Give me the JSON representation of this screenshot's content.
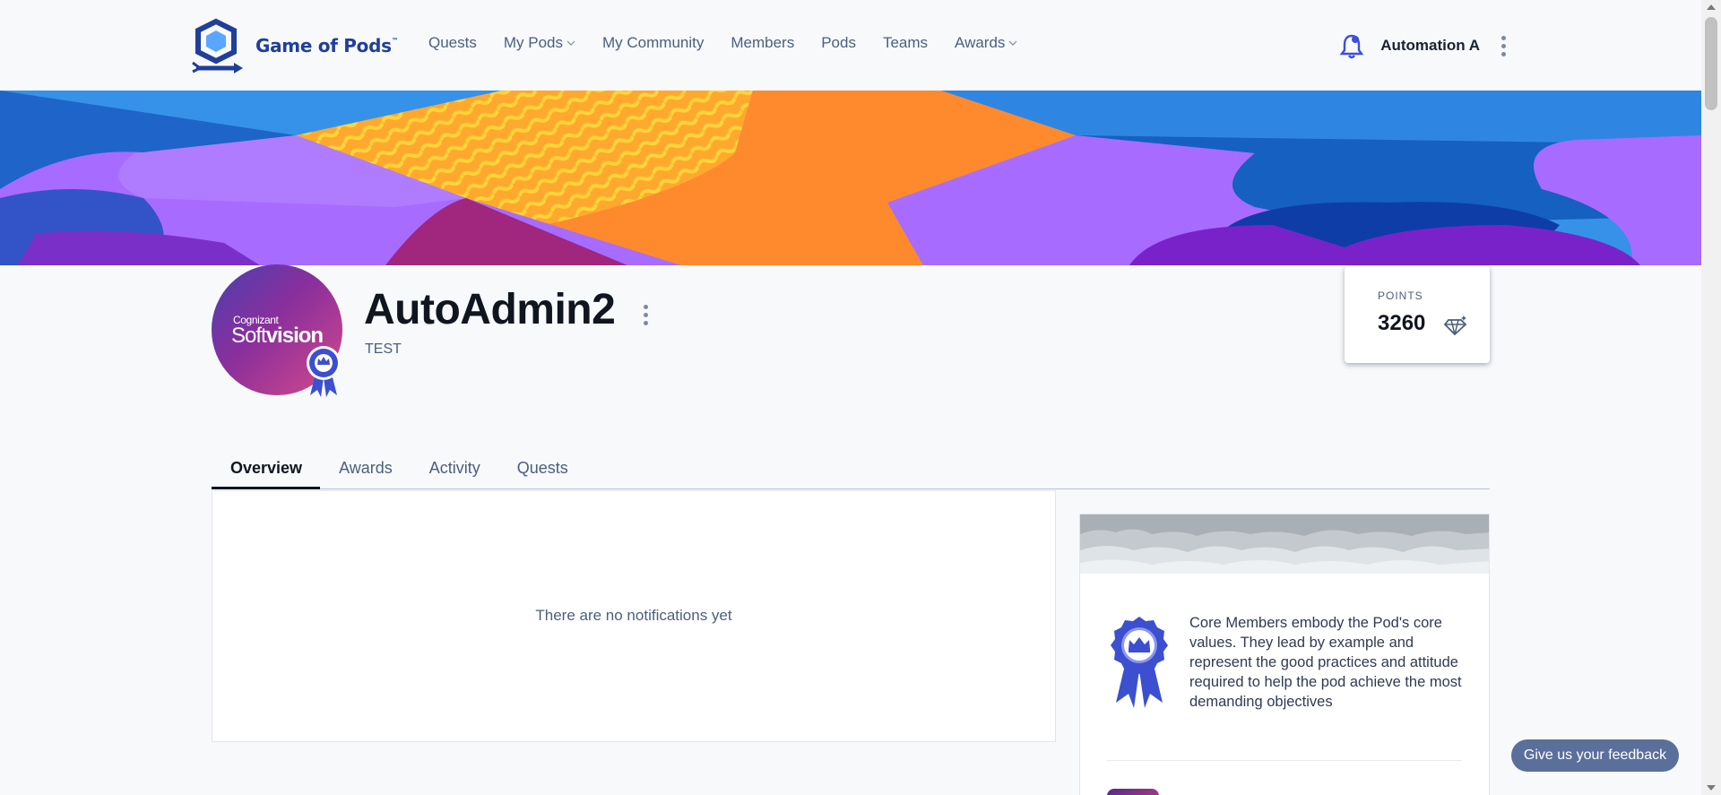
{
  "header": {
    "brand": "Game of Pods",
    "brand_mark": "™",
    "nav": [
      {
        "label": "Quests",
        "dropdown": false
      },
      {
        "label": "My Pods",
        "dropdown": true
      },
      {
        "label": "My Community",
        "dropdown": false
      },
      {
        "label": "Members",
        "dropdown": false
      },
      {
        "label": "Pods",
        "dropdown": false
      },
      {
        "label": "Teams",
        "dropdown": false
      },
      {
        "label": "Awards",
        "dropdown": true
      }
    ],
    "user_name": "Automation A",
    "icons": {
      "notification": "bell-icon",
      "more": "kebab-icon"
    }
  },
  "profile": {
    "name": "AutoAdmin2",
    "subtitle": "TEST",
    "avatar_text_small": "Cognizant",
    "avatar_text_soft": "Soft",
    "avatar_text_vision": "vision",
    "points_label": "POINTS",
    "points_value": "3260"
  },
  "tabs": [
    {
      "label": "Overview",
      "active": true
    },
    {
      "label": "Awards",
      "active": false
    },
    {
      "label": "Activity",
      "active": false
    },
    {
      "label": "Quests",
      "active": false
    }
  ],
  "notifications": {
    "empty_message": "There are no notifications yet"
  },
  "core_member": {
    "description": "Core Members embody the Pod's core values. They lead by example and represent the good practices and attitude required to help the pod achieve the most demanding objectives"
  },
  "feedback": {
    "label": "Give us your feedback"
  },
  "colors": {
    "brand": "#1f3f99",
    "accent": "#4a5ce8",
    "banner_blue": "#3592e8",
    "banner_orange": "#ff8a2e",
    "banner_purple": "#a86bff",
    "feedback_bg": "#5a6f9a"
  }
}
